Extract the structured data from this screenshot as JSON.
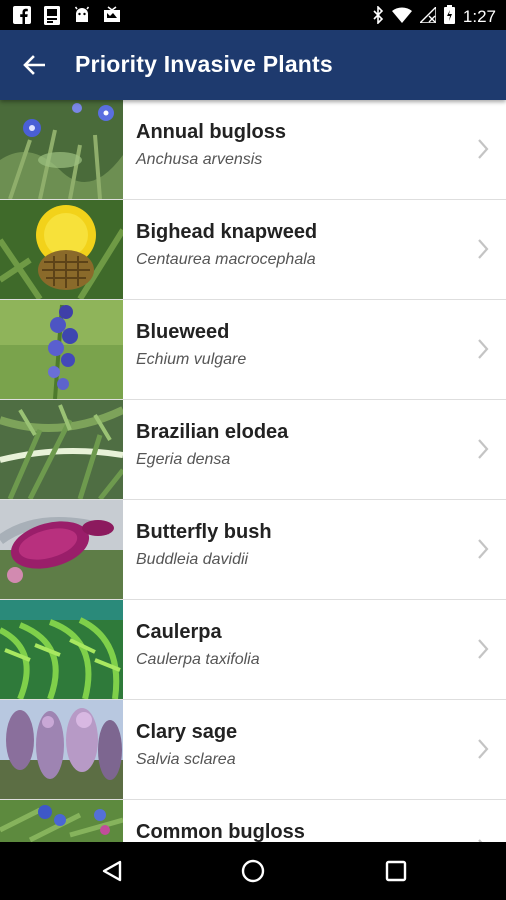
{
  "status_bar": {
    "time": "1:27",
    "left_icons": [
      "facebook-icon",
      "document-icon",
      "android-icon",
      "news-icon"
    ],
    "right_icons": [
      "bluetooth-icon",
      "wifi-icon",
      "no-signal-icon",
      "battery-icon"
    ]
  },
  "app_bar": {
    "title": "Priority Invasive Plants",
    "background": "#1e3a6e"
  },
  "plants": [
    {
      "common": "Annual bugloss",
      "scientific": "Anchusa arvensis"
    },
    {
      "common": "Bighead knapweed",
      "scientific": "Centaurea macrocephala"
    },
    {
      "common": "Blueweed",
      "scientific": "Echium vulgare"
    },
    {
      "common": "Brazilian elodea",
      "scientific": "Egeria densa"
    },
    {
      "common": "Butterfly bush",
      "scientific": "Buddleia davidii"
    },
    {
      "common": "Caulerpa",
      "scientific": "Caulerpa taxifolia"
    },
    {
      "common": "Clary sage",
      "scientific": "Salvia sclarea"
    },
    {
      "common": "Common bugloss",
      "scientific": ""
    }
  ],
  "nav_bar": {
    "icons": [
      "back-triangle-icon",
      "home-circle-icon",
      "recents-square-icon"
    ]
  }
}
